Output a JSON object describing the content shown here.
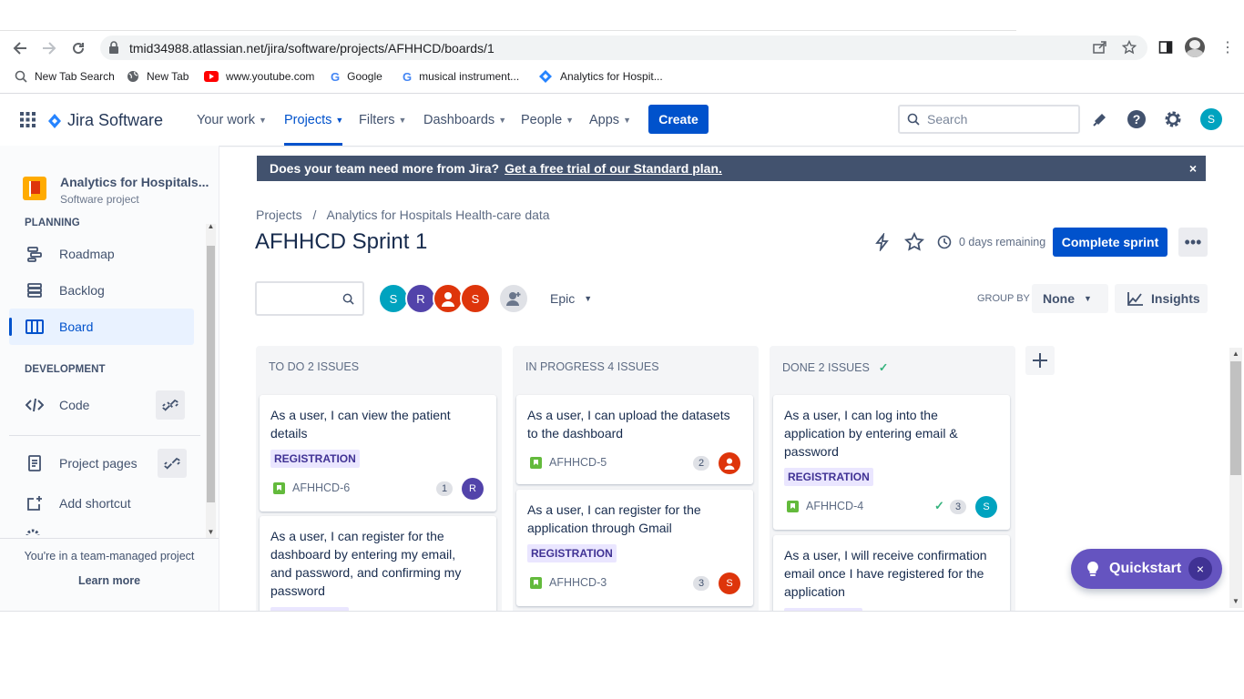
{
  "browser": {
    "url": "tmid34988.atlassian.net/jira/software/projects/AFHHCD/boards/1",
    "bookmarks": [
      "New Tab Search",
      "New Tab",
      "www.youtube.com",
      "Google",
      "musical instrument...",
      "Analytics for Hospit..."
    ]
  },
  "topnav": {
    "product": "Jira Software",
    "items": [
      "Your work",
      "Projects",
      "Filters",
      "Dashboards",
      "People",
      "Apps"
    ],
    "create": "Create",
    "search_placeholder": "Search",
    "user_initial": "S"
  },
  "sidebar": {
    "project_name": "Analytics for Hospitals...",
    "project_type": "Software project",
    "planning_heading": "PLANNING",
    "planning_items": [
      "Roadmap",
      "Backlog",
      "Board"
    ],
    "development_heading": "DEVELOPMENT",
    "code": "Code",
    "project_pages": "Project pages",
    "add_shortcut": "Add shortcut",
    "footer_text": "You're in a team-managed project",
    "learn_more": "Learn more"
  },
  "banner": {
    "text": "Does your team need more from Jira?",
    "link": "Get a free trial of our Standard plan.",
    "close": "×"
  },
  "breadcrumb": {
    "root": "Projects",
    "sep": "/",
    "project": "Analytics for Hospitals Health-care data"
  },
  "sprint": {
    "title": "AFHHCD Sprint 1",
    "days_remaining": "0 days remaining",
    "complete_button": "Complete sprint",
    "more": "•••"
  },
  "filters": {
    "avatars": [
      "S",
      "R",
      "",
      "S"
    ],
    "epic": "Epic",
    "group_by_label": "GROUP BY",
    "group_by_value": "None",
    "insights": "Insights"
  },
  "columns": [
    {
      "title": "TO DO 2 ISSUES",
      "done_check": "",
      "cards": [
        {
          "summary": "As a user, I can view the patient details",
          "label": "REGISTRATION",
          "key": "AFHHCD-6",
          "points": "1",
          "assignee": "R"
        },
        {
          "summary": "As a user, I can register for the dashboard by entering my email, and password, and confirming my password",
          "label": "REGISTRATION",
          "key": "",
          "points": "",
          "assignee": ""
        }
      ]
    },
    {
      "title": "IN PROGRESS 4 ISSUES",
      "done_check": "",
      "cards": [
        {
          "summary": "As a user, I can upload the datasets to the dashboard",
          "label": "",
          "key": "AFHHCD-5",
          "points": "2",
          "assignee": ""
        },
        {
          "summary": "As a user, I can register for the application through Gmail",
          "label": "REGISTRATION",
          "key": "AFHHCD-3",
          "points": "3",
          "assignee": "S"
        }
      ]
    },
    {
      "title": "DONE 2 ISSUES",
      "done_check": "✓",
      "cards": [
        {
          "summary": "As a user, I can log into the application by entering email & password",
          "label": "REGISTRATION",
          "key": "AFHHCD-4",
          "points": "3",
          "assignee": "S"
        },
        {
          "summary": "As a user, I will receive confirmation email once I have registered for the application",
          "label": "",
          "key": "",
          "points": "",
          "assignee": ""
        }
      ]
    }
  ],
  "quickstart": {
    "label": "Quickstart",
    "close": "×"
  },
  "colors": {
    "primary": "#0052cc",
    "banner": "#42526e",
    "quickstart": "#6554c0",
    "story": "#63ba3c",
    "label_bg": "#eae6ff"
  }
}
